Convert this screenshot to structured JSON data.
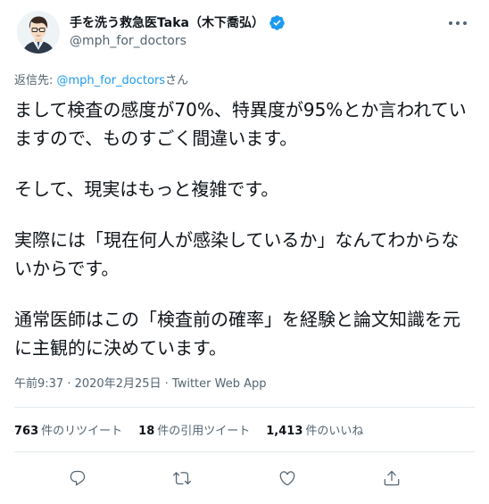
{
  "author": {
    "display_name": "手を洗う救急医Taka（木下喬弘）",
    "handle": "@mph_for_doctors",
    "verified": true,
    "verified_color": "#1d9bf0"
  },
  "reply": {
    "prefix": "返信先: ",
    "mention": "@mph_for_doctors",
    "suffix": "さん"
  },
  "body": {
    "paragraphs": [
      "まして検査の感度が70%、特異度が95%とか言われていますので、ものすごく間違います。",
      "そして、現実はもっと複雑です。",
      "実際には「現在何人が感染しているか」なんてわからないからです。",
      "通常医師はこの「検査前の確率」を経験と論文知識を元に主観的に決めています。"
    ]
  },
  "meta": {
    "time": "午前9:37",
    "separator": " · ",
    "date": "2020年2月25日",
    "app": "Twitter Web App"
  },
  "stats": {
    "retweets": {
      "count": "763",
      "label": "件のリツイート"
    },
    "quotes": {
      "count": "18",
      "label": "件の引用ツイート"
    },
    "likes": {
      "count": "1,413",
      "label": "件のいいね"
    }
  },
  "icons": {
    "more": "more-horizontal-icon",
    "reply": "reply-icon",
    "retweet": "retweet-icon",
    "like": "heart-icon",
    "share": "share-icon"
  },
  "colors": {
    "text": "#0f1419",
    "secondary": "#536471",
    "accent": "#1d9bf0",
    "divider": "#e1e8ed"
  }
}
